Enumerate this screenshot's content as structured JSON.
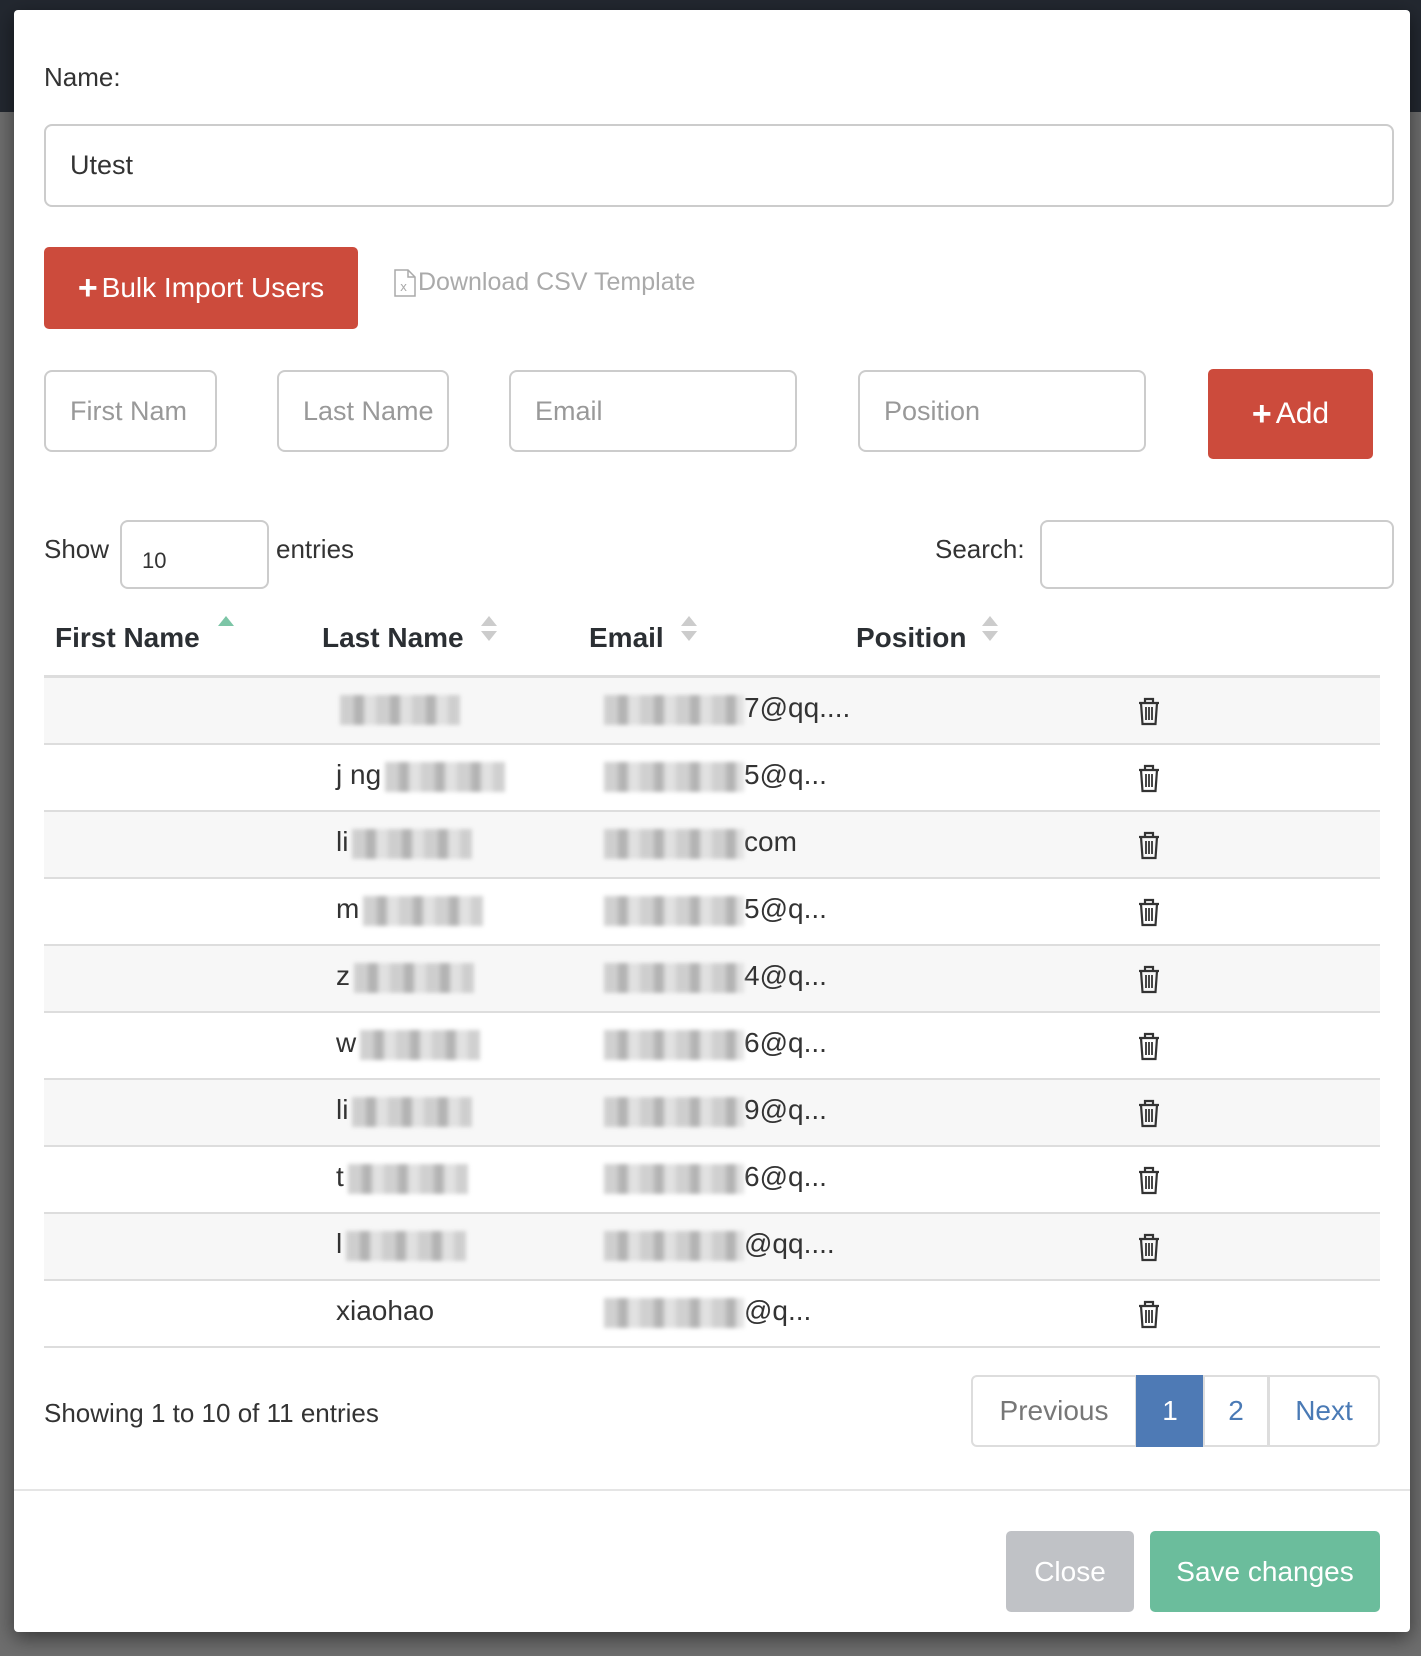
{
  "form": {
    "name_label": "Name:",
    "name_value": "Utest",
    "bulk_import_label": "Bulk Import Users",
    "download_template_label": "Download CSV Template",
    "first_name_placeholder": "First Nam",
    "last_name_placeholder": "Last Name",
    "email_placeholder": "Email",
    "position_placeholder": "Position",
    "add_label": "Add"
  },
  "table_controls": {
    "show_label": "Show",
    "entries_value": "10",
    "entries_label": "entries",
    "search_label": "Search:",
    "search_value": ""
  },
  "table": {
    "columns": [
      "First Name",
      "Last Name",
      "Email",
      "Position"
    ],
    "sorted_column": "First Name",
    "rows": [
      {
        "first_name": "",
        "last_name": "",
        "email": "7@qq....",
        "position": ""
      },
      {
        "first_name": "",
        "last_name": "j ng",
        "email": "5@q...",
        "position": ""
      },
      {
        "first_name": "",
        "last_name": "li",
        "email": "com",
        "position": ""
      },
      {
        "first_name": "",
        "last_name": "m",
        "email": "5@q...",
        "position": ""
      },
      {
        "first_name": "",
        "last_name": "z",
        "email": "4@q...",
        "position": ""
      },
      {
        "first_name": "",
        "last_name": "w",
        "email": "6@q...",
        "position": ""
      },
      {
        "first_name": "",
        "last_name": "li",
        "email": "9@q...",
        "position": ""
      },
      {
        "first_name": "",
        "last_name": "t",
        "email": "6@q...",
        "position": ""
      },
      {
        "first_name": "",
        "last_name": "l",
        "email": "@qq....",
        "position": ""
      },
      {
        "first_name": "",
        "last_name": "xiaohao",
        "email": "@q...",
        "position": ""
      }
    ]
  },
  "footer_info": "Showing 1 to 10 of 11 entries",
  "pagination": {
    "previous": "Previous",
    "pages": [
      "1",
      "2"
    ],
    "current": "1",
    "next": "Next"
  },
  "buttons": {
    "close": "Close",
    "save": "Save changes"
  },
  "colors": {
    "danger": "#cc4b3c",
    "primary": "#4e7ab5",
    "success": "#6bbd9c",
    "disabled": "#c0c2c6"
  }
}
